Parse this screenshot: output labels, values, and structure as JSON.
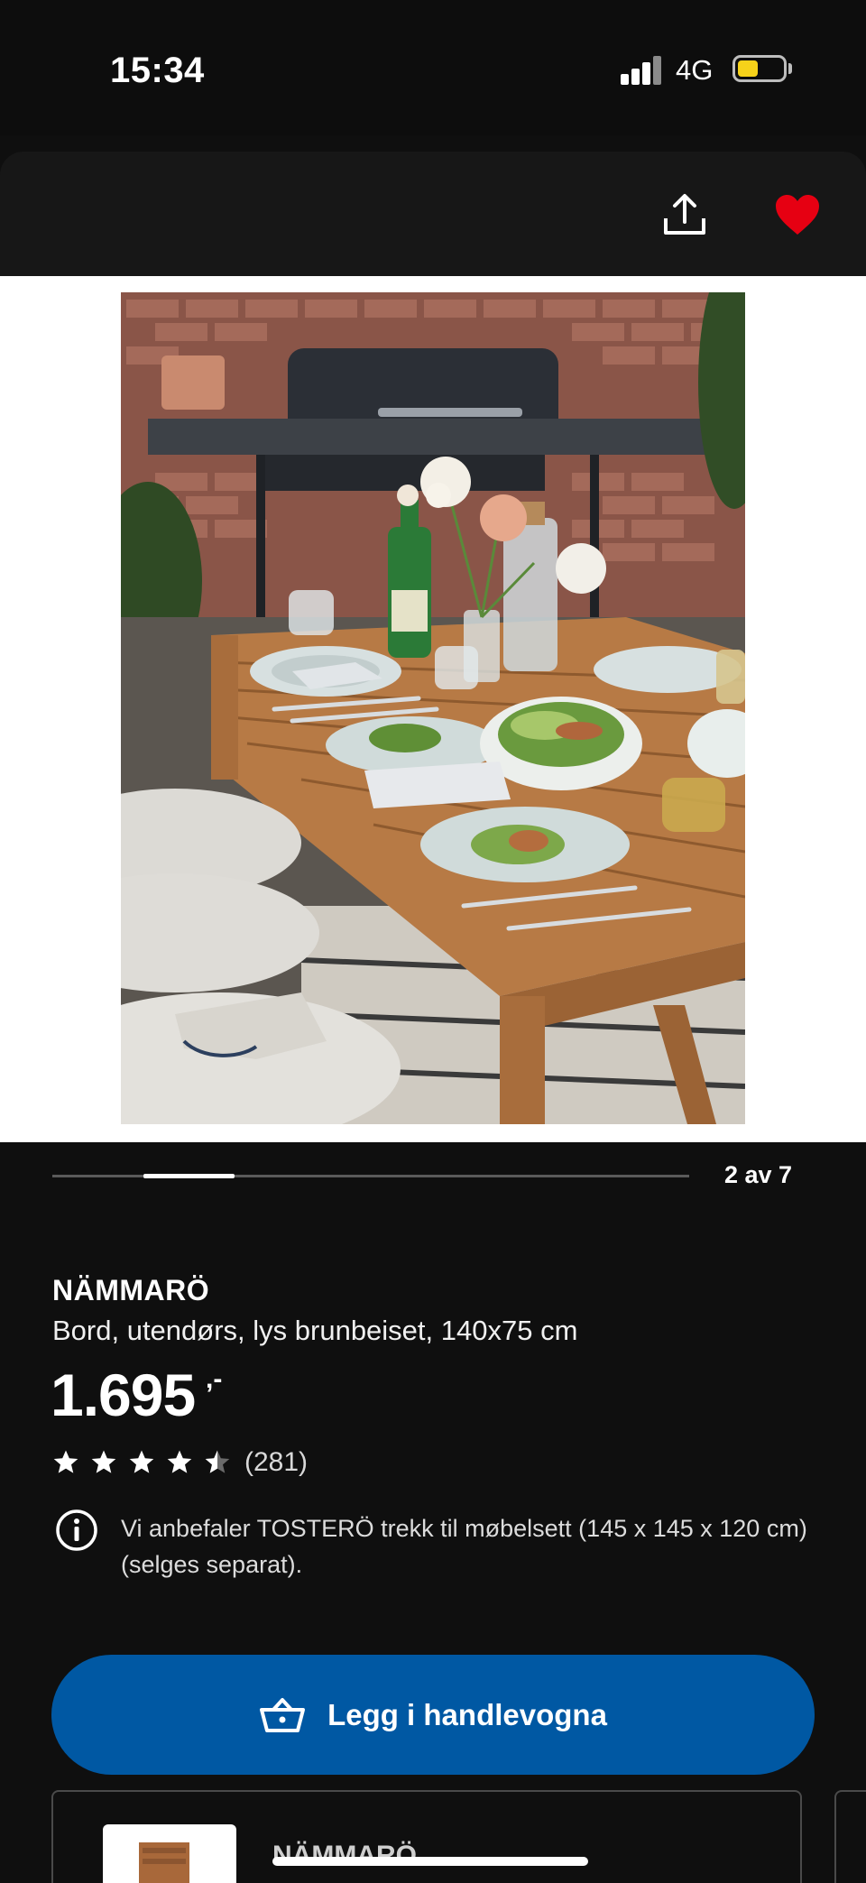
{
  "status_bar": {
    "time": "15:34",
    "network": "4G",
    "battery_level": 0.45,
    "battery_color": "#f6d21a"
  },
  "header": {
    "share_icon": "share-icon",
    "favorite_icon": "heart-icon",
    "favorite_color": "#e60012"
  },
  "gallery": {
    "counter": "2 av 7",
    "current": 2,
    "total": 7
  },
  "product": {
    "name": "NÄMMARÖ",
    "description": "Bord, utendørs, lys brunbeiset, 140x75 cm",
    "price": "1.695",
    "price_suffix": ",-",
    "rating": 4.5,
    "rating_count": "(281)",
    "info_text": "Vi anbefaler TOSTERÖ trekk til møbelsett (145 x 145 x 120 cm) (selges separat)."
  },
  "cta": {
    "label": "Legg i handlevogna",
    "icon": "basket-icon",
    "color": "#0058a3"
  },
  "related": {
    "name": "NÄMMARÖ"
  }
}
